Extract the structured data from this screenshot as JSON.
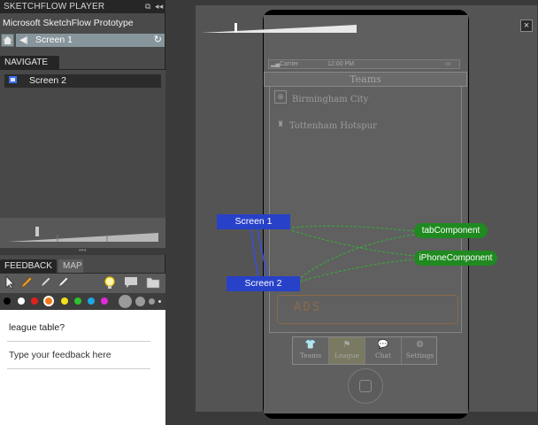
{
  "player": {
    "title": "SKETCHFLOW PLAYER",
    "app_name": "Microsoft SketchFlow Prototype",
    "current_screen": "Screen 1"
  },
  "navigate": {
    "tab_label": "NAVIGATE",
    "items": [
      {
        "label": "Screen 2"
      }
    ]
  },
  "feedback": {
    "tabs": [
      {
        "label": "FEEDBACK",
        "active": true
      },
      {
        "label": "MAP",
        "active": false
      }
    ],
    "tools": [
      "select-arrow-icon",
      "pencil-icon",
      "highlighter-icon",
      "eraser-icon",
      "lightbulb-icon",
      "comment-icon",
      "folder-icon"
    ],
    "ink_colors": [
      "#000000",
      "#ffffff",
      "#e02020",
      "#f07a1a",
      "#f2e018",
      "#2ec22e",
      "#1fa6e6",
      "#e22ad8"
    ],
    "entries": [
      "league table?",
      "Type your feedback here"
    ]
  },
  "prototype": {
    "status_carrier": "Carrier",
    "status_time": "12:00 PM",
    "header": "Teams",
    "teams": [
      "Birmingham City",
      "Tottenham Hotspur"
    ],
    "ads_label": "ADS",
    "tabbar": [
      {
        "label": "Teams",
        "icon": "shirt-icon"
      },
      {
        "label": "League",
        "icon": "flag-icon"
      },
      {
        "label": "Chat",
        "icon": "chat-bubble-icon"
      },
      {
        "label": "Settings",
        "icon": "gear-icon"
      }
    ]
  },
  "map": {
    "screens": [
      "Screen 1",
      "Screen 2"
    ],
    "components": [
      "tabComponent",
      "iPhoneComponent"
    ],
    "colors": {
      "screen_node": "#2741c8",
      "component_node": "#1f8a1f",
      "screen_link": "#3550e0",
      "component_link": "#34b234"
    }
  },
  "controls": {
    "close_symbol": "×"
  }
}
